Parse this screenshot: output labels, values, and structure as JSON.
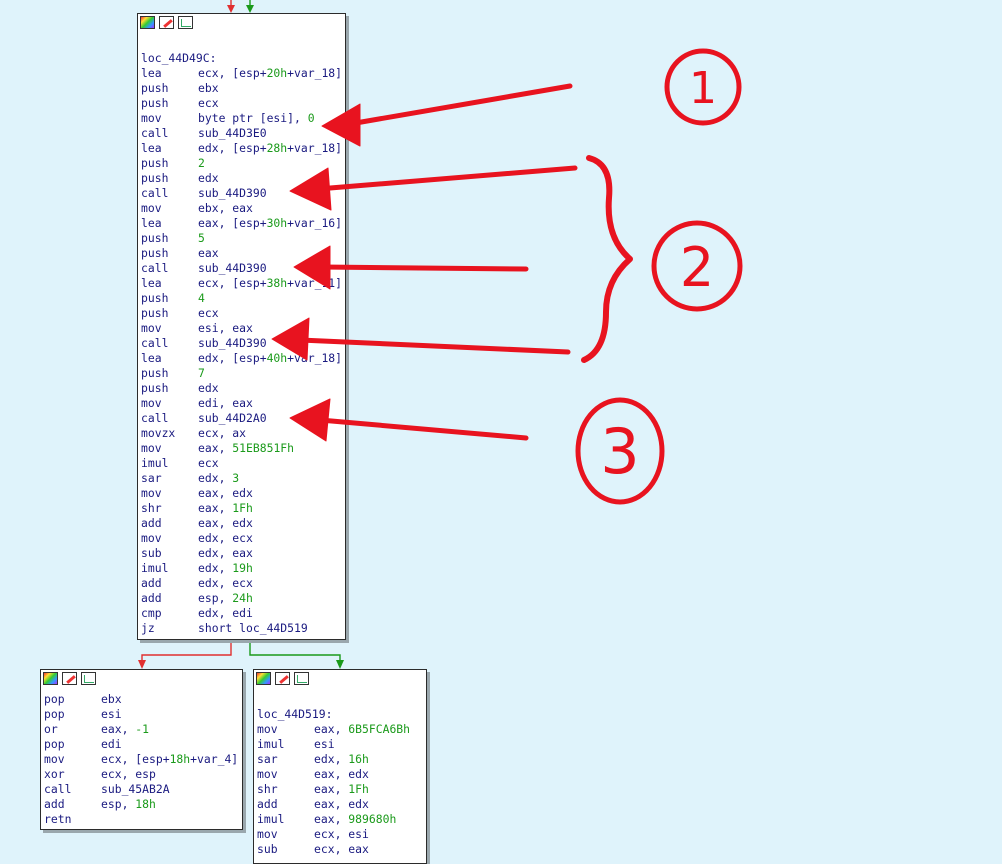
{
  "colors": {
    "background": "#dff3fb",
    "node_border": "#2b2b2b",
    "code_text": "#1a1a80",
    "number_text": "#1b9a1b",
    "edge_false": "#e03030",
    "edge_true": "#1a9a1a",
    "annotation": "#e8131f"
  },
  "header_icons": [
    "palette-icon",
    "pencil-icon",
    "graph-icon"
  ],
  "nodes": {
    "main": {
      "lines": [
        {
          "m": "",
          "o": ""
        },
        {
          "m": "loc_44D49C:",
          "o": ""
        },
        {
          "m": "lea",
          "o": "ecx, [esp+|20h|+var_18]"
        },
        {
          "m": "push",
          "o": "ebx"
        },
        {
          "m": "push",
          "o": "ecx"
        },
        {
          "m": "mov",
          "o": "byte ptr [esi], |0|"
        },
        {
          "m": "call",
          "o": "sub_44D3E0"
        },
        {
          "m": "lea",
          "o": "edx, [esp+|28h|+var_18]"
        },
        {
          "m": "push",
          "o": "|2|"
        },
        {
          "m": "push",
          "o": "edx"
        },
        {
          "m": "call",
          "o": "sub_44D390"
        },
        {
          "m": "mov",
          "o": "ebx, eax"
        },
        {
          "m": "lea",
          "o": "eax, [esp+|30h|+var_16]"
        },
        {
          "m": "push",
          "o": "|5|"
        },
        {
          "m": "push",
          "o": "eax"
        },
        {
          "m": "call",
          "o": "sub_44D390"
        },
        {
          "m": "lea",
          "o": "ecx, [esp+|38h|+var_11]"
        },
        {
          "m": "push",
          "o": "|4|"
        },
        {
          "m": "push",
          "o": "ecx"
        },
        {
          "m": "mov",
          "o": "esi, eax"
        },
        {
          "m": "call",
          "o": "sub_44D390"
        },
        {
          "m": "lea",
          "o": "edx, [esp+|40h|+var_18]"
        },
        {
          "m": "push",
          "o": "|7|"
        },
        {
          "m": "push",
          "o": "edx"
        },
        {
          "m": "mov",
          "o": "edi, eax"
        },
        {
          "m": "call",
          "o": "sub_44D2A0"
        },
        {
          "m": "movzx",
          "o": "ecx, ax"
        },
        {
          "m": "mov",
          "o": "eax, |51EB851Fh|"
        },
        {
          "m": "imul",
          "o": "ecx"
        },
        {
          "m": "sar",
          "o": "edx, |3|"
        },
        {
          "m": "mov",
          "o": "eax, edx"
        },
        {
          "m": "shr",
          "o": "eax, |1Fh|"
        },
        {
          "m": "add",
          "o": "eax, edx"
        },
        {
          "m": "mov",
          "o": "edx, ecx"
        },
        {
          "m": "sub",
          "o": "edx, eax"
        },
        {
          "m": "imul",
          "o": "edx, |19h|"
        },
        {
          "m": "add",
          "o": "edx, ecx"
        },
        {
          "m": "add",
          "o": "esp, |24h|"
        },
        {
          "m": "cmp",
          "o": "edx, edi"
        },
        {
          "m": "jz",
          "o": "short loc_44D519"
        }
      ]
    },
    "left": {
      "lines": [
        {
          "m": "pop",
          "o": "ebx"
        },
        {
          "m": "pop",
          "o": "esi"
        },
        {
          "m": "or",
          "o": "eax, |-1|"
        },
        {
          "m": "pop",
          "o": "edi"
        },
        {
          "m": "mov",
          "o": "ecx, [esp+|18h|+var_4]"
        },
        {
          "m": "xor",
          "o": "ecx, esp"
        },
        {
          "m": "call",
          "o": "sub_45AB2A"
        },
        {
          "m": "add",
          "o": "esp, |18h|"
        },
        {
          "m": "retn",
          "o": ""
        }
      ]
    },
    "right": {
      "lines": [
        {
          "m": "",
          "o": ""
        },
        {
          "m": "loc_44D519:",
          "o": ""
        },
        {
          "m": "mov",
          "o": "eax, |6B5FCA6Bh|"
        },
        {
          "m": "imul",
          "o": "esi"
        },
        {
          "m": "sar",
          "o": "edx, |16h|"
        },
        {
          "m": "mov",
          "o": "eax, edx"
        },
        {
          "m": "shr",
          "o": "eax, |1Fh|"
        },
        {
          "m": "add",
          "o": "eax, edx"
        },
        {
          "m": "imul",
          "o": "eax, |989680h|"
        },
        {
          "m": "mov",
          "o": "ecx, esi"
        },
        {
          "m": "sub",
          "o": "ecx, eax"
        }
      ]
    }
  },
  "annotations": {
    "labels": [
      "1",
      "2",
      "3"
    ]
  }
}
